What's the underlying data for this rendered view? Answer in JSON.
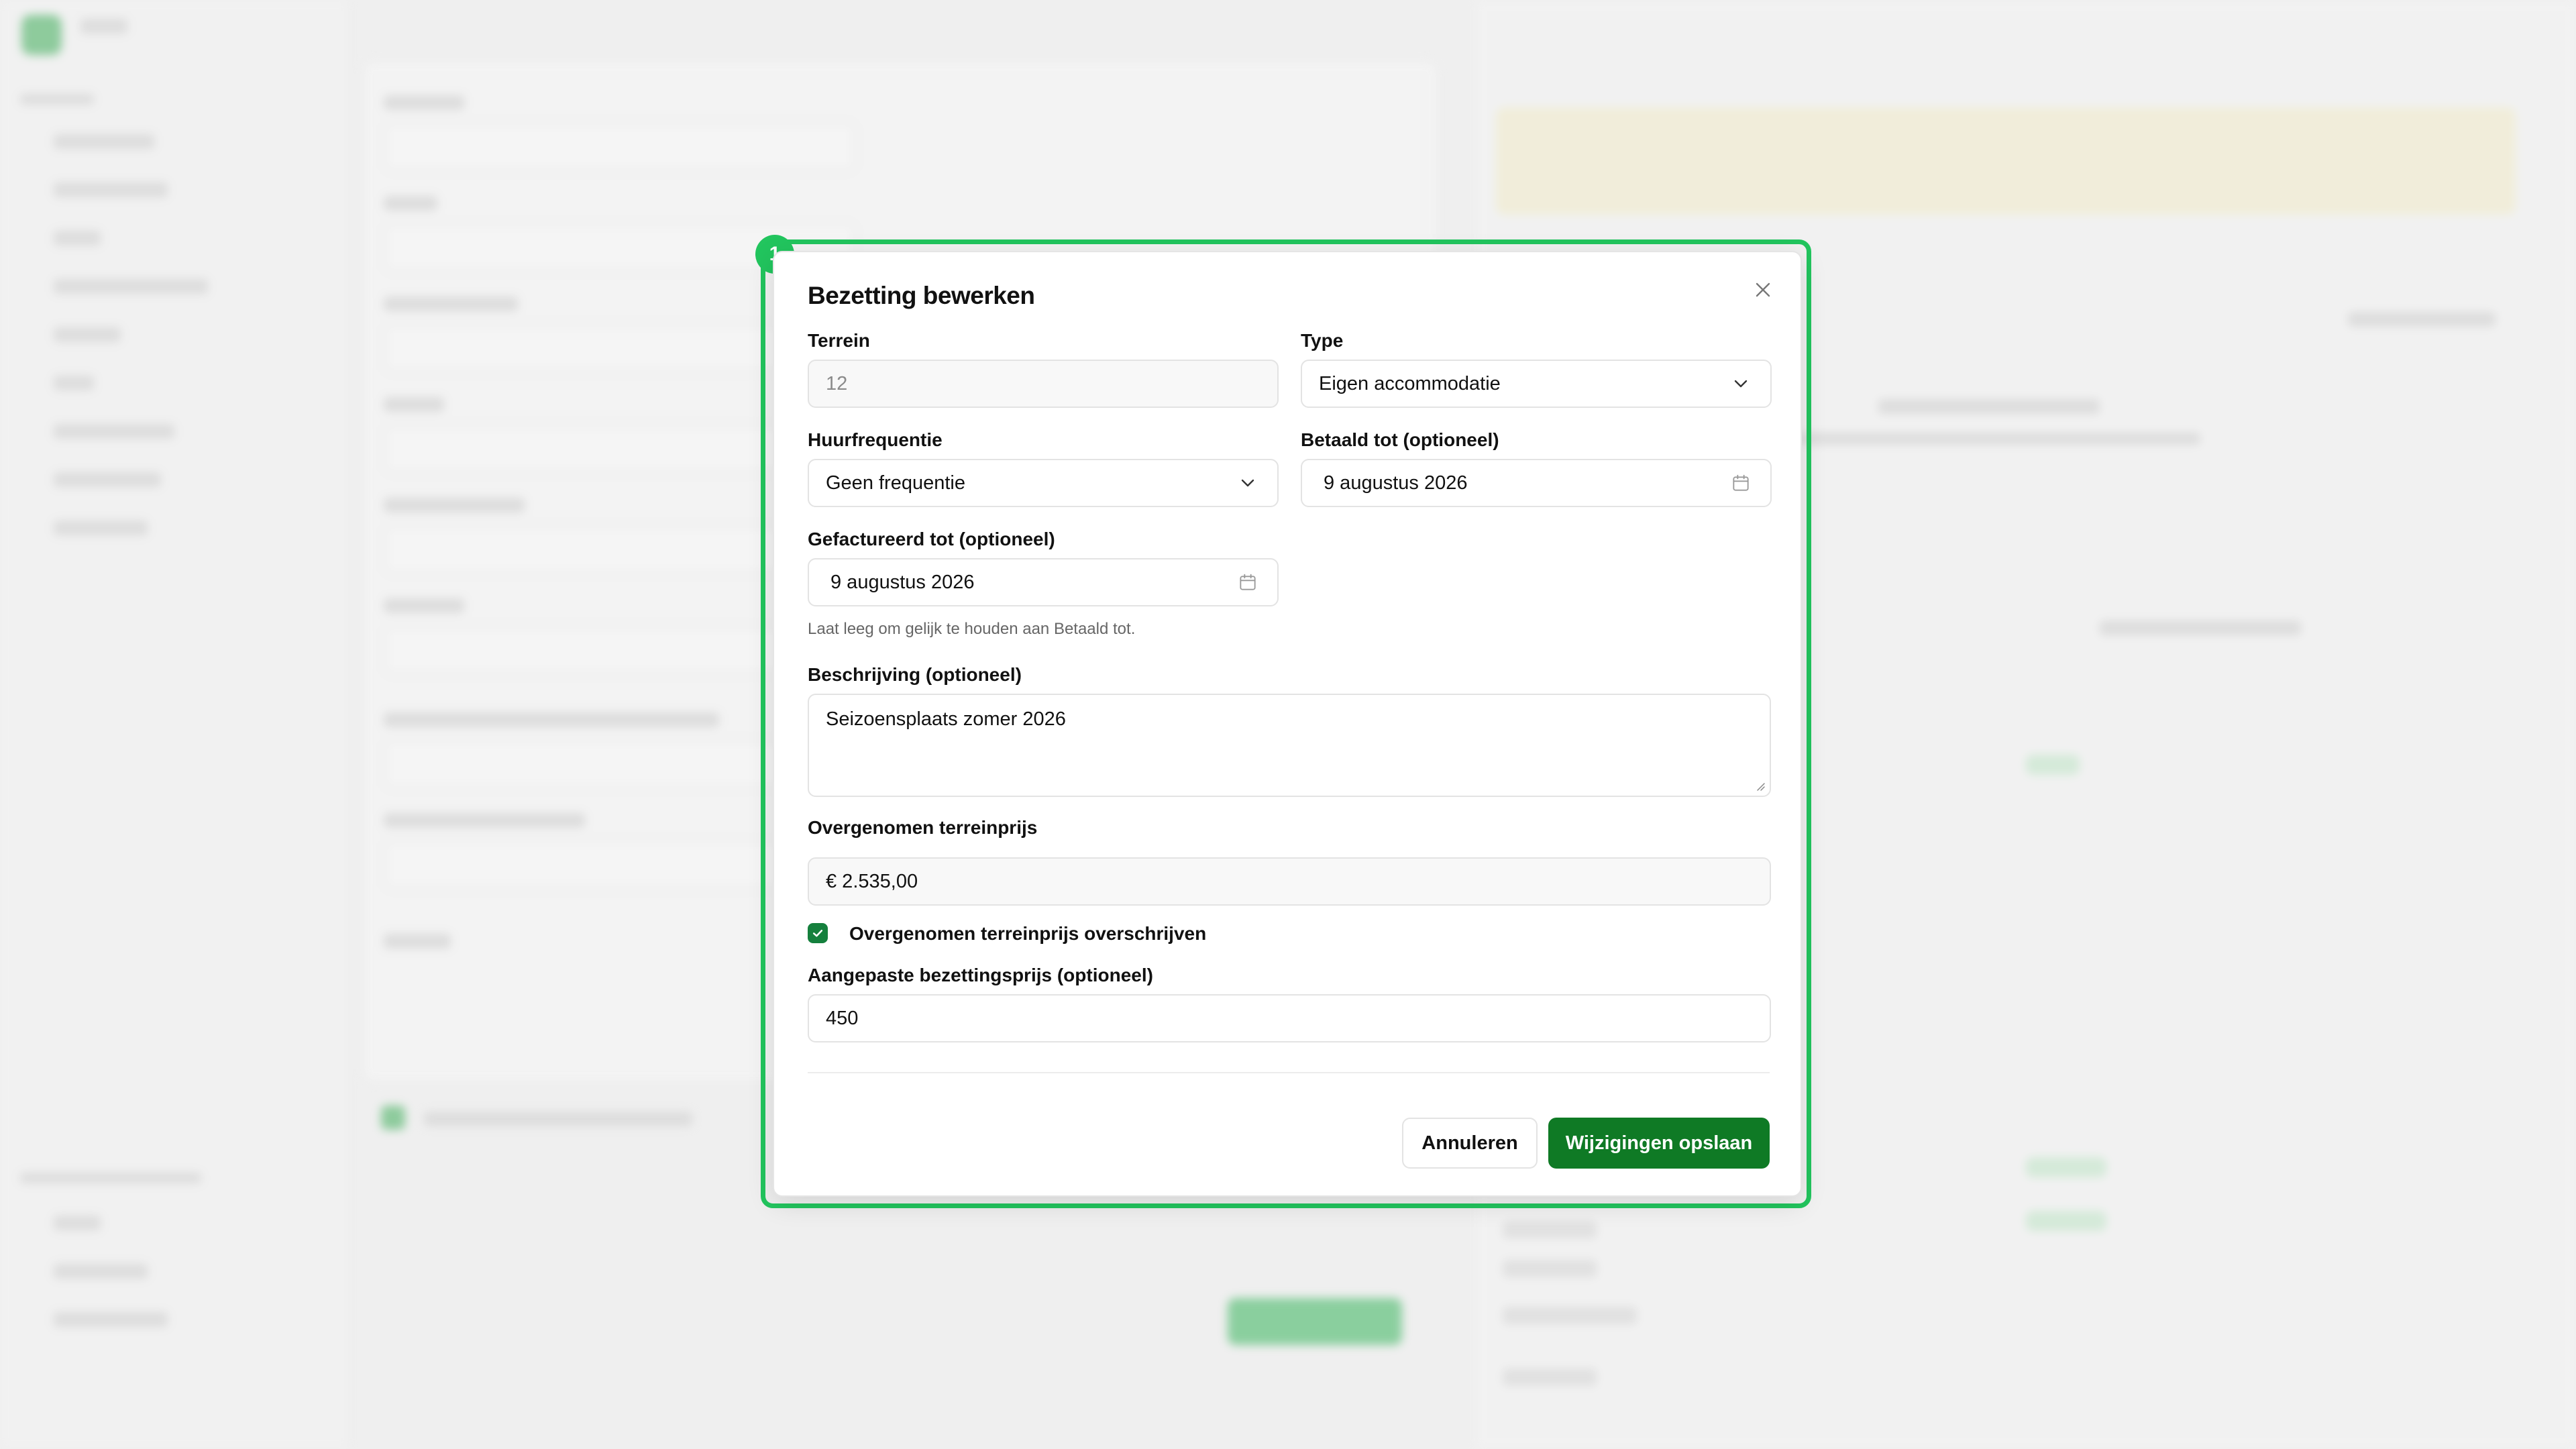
{
  "modal": {
    "badge_number": "1",
    "title": "Bezetting bewerken",
    "fields": {
      "terrein": {
        "label": "Terrein",
        "value": "12"
      },
      "type": {
        "label": "Type",
        "value": "Eigen accommodatie",
        "icon": "chevron-down-icon"
      },
      "huurfrequentie": {
        "label": "Huurfrequentie",
        "value": "Geen frequentie",
        "icon": "chevron-down-icon"
      },
      "betaald_tot": {
        "label": "Betaald tot (optioneel)",
        "value": "9 augustus 2026",
        "icon": "calendar-icon"
      },
      "gefactureerd_tot": {
        "label": "Gefactureerd tot (optioneel)",
        "value": "9 augustus 2026",
        "icon": "calendar-icon",
        "hint": "Laat leeg om gelijk te houden aan Betaald tot."
      },
      "beschrijving": {
        "label": "Beschrijving (optioneel)",
        "value": "Seizoensplaats zomer 2026"
      },
      "terreinprijs": {
        "label": "Overgenomen terreinprijs",
        "value": "€ 2.535,00"
      },
      "overschrijven": {
        "label": "Overgenomen terreinprijs overschrijven",
        "checked": true
      },
      "aangepaste_prijs": {
        "label": "Aangepaste bezettingsprijs (optioneel)",
        "value": "450"
      }
    },
    "buttons": {
      "cancel": "Annuleren",
      "save": "Wijzigingen opslaan"
    },
    "colors": {
      "highlight": "#22c55e",
      "primary": "#0f7a25"
    }
  }
}
